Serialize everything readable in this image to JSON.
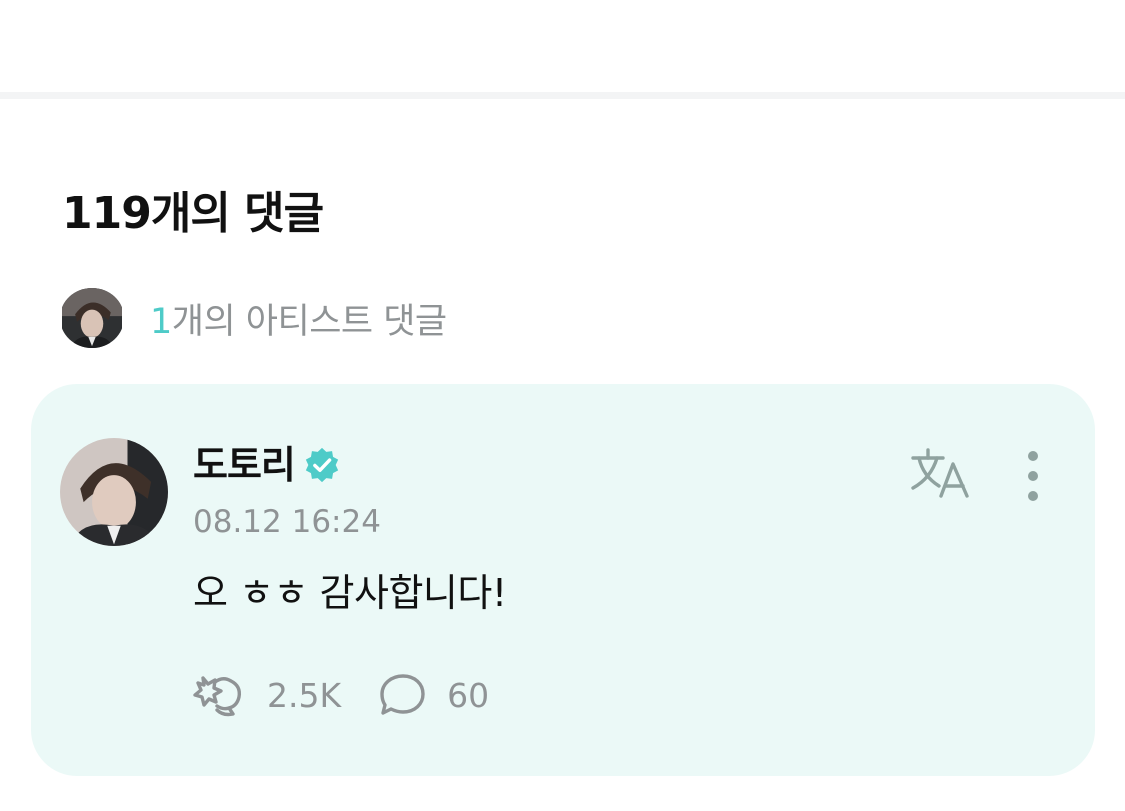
{
  "comments_header": {
    "title": "119개의 댓글"
  },
  "artist_comments": {
    "count": "1",
    "label": "개의 아티스트 댓글"
  },
  "comment": {
    "author": "도토리",
    "verified_icon": "verified-badge-icon",
    "timestamp": "08.12 16:24",
    "text": "오 ㅎㅎ 감사합니다!",
    "likes": "2.5K",
    "replies": "60",
    "icons": {
      "like": "cheer-hand-icon",
      "reply": "speech-bubble-icon",
      "translate": "translate-icon",
      "more": "more-vertical-icon"
    }
  },
  "colors": {
    "accent": "#4ecbc8",
    "card_background": "#ebf9f7",
    "muted_text": "#8f9395",
    "icon_gray": "#8fa29f"
  }
}
